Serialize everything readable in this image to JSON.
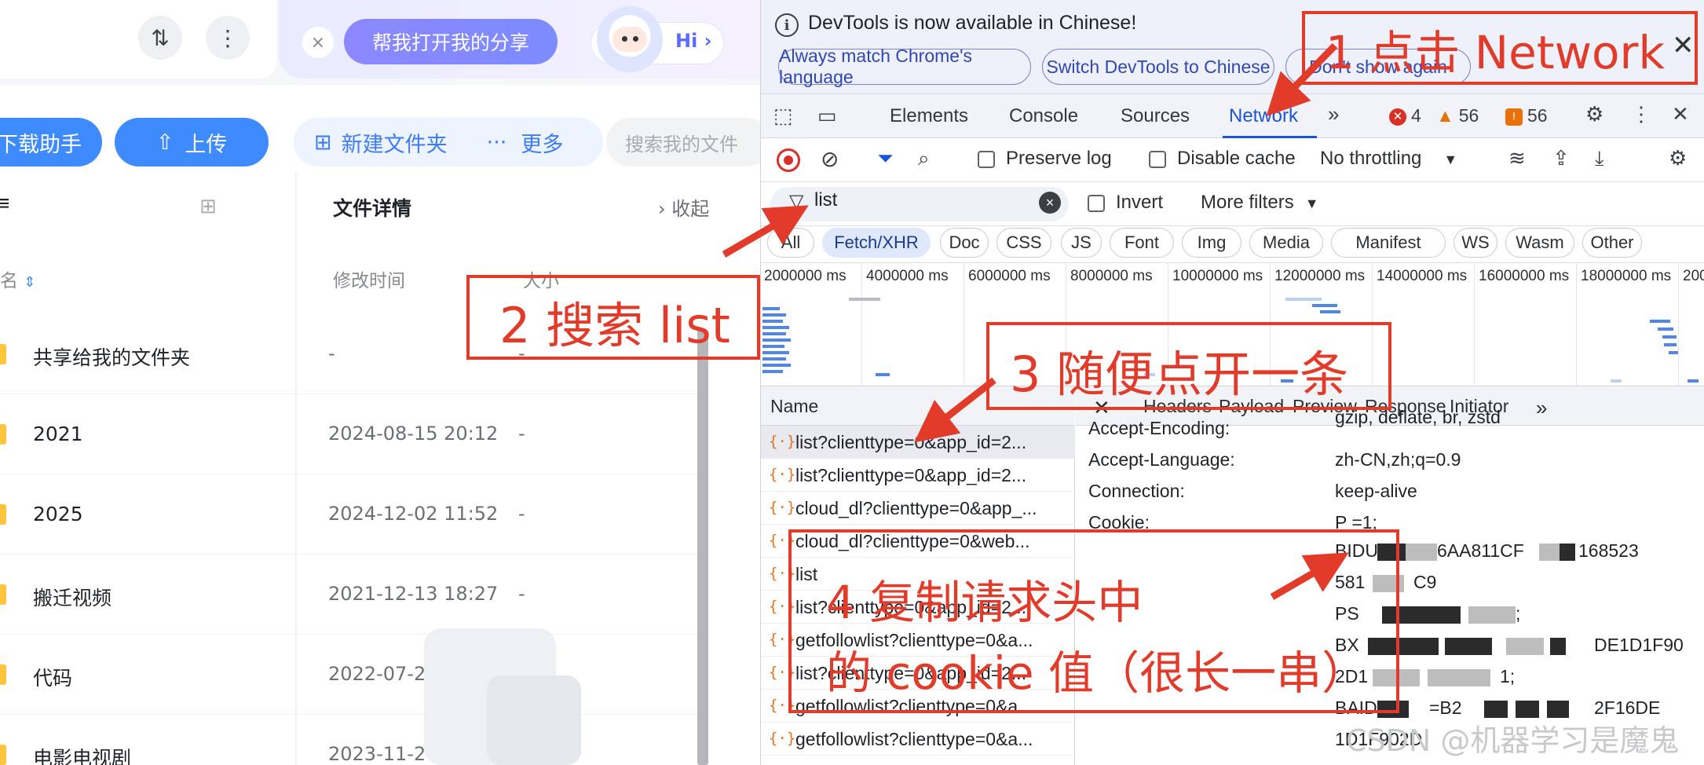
{
  "drive": {
    "ai_prompt": "帮我打开我的分享",
    "hi": "Hi",
    "download_btn": "下载助手",
    "upload_btn": "上传",
    "new_folder_btn": "新建文件夹",
    "more_btn": "更多",
    "search_placeholder": "搜索我的文件",
    "detail_title": "文件详情",
    "collapse": "收起",
    "col_name": "名",
    "col_modified": "修改时间",
    "col_size": "大小",
    "rows": [
      {
        "name": "共享给我的文件夹",
        "modified": "-",
        "size": "-"
      },
      {
        "name": "2021",
        "modified": "2024-08-15 20:12",
        "size": "-"
      },
      {
        "name": "2025",
        "modified": "2024-12-02 11:52",
        "size": "-"
      },
      {
        "name": "搬迁视频",
        "modified": "2021-12-13 18:27",
        "size": "-"
      },
      {
        "name": "代码",
        "modified": "2022-07-2",
        "size": ""
      },
      {
        "name": "电影电视剧",
        "modified": "2023-11-24 09:48",
        "size": ""
      }
    ]
  },
  "devtools": {
    "info_text": "DevTools is now available in Chinese!",
    "info_buttons": [
      "Always match Chrome's language",
      "Switch DevTools to Chinese",
      "Don't show again"
    ],
    "tabs": [
      "Elements",
      "Console",
      "Sources",
      "Network"
    ],
    "issues": {
      "errors": "4",
      "warnings": "56",
      "info": "56"
    },
    "preserve_log": "Preserve log",
    "disable_cache": "Disable cache",
    "throttling": "No throttling",
    "filter_value": "list",
    "invert": "Invert",
    "more_filters": "More filters",
    "type_filters": [
      "All",
      "Fetch/XHR",
      "Doc",
      "CSS",
      "JS",
      "Font",
      "Img",
      "Media",
      "Manifest",
      "WS",
      "Wasm",
      "Other"
    ],
    "timeline_ticks": [
      "2000000 ms",
      "4000000 ms",
      "6000000 ms",
      "8000000 ms",
      "10000000 ms",
      "12000000 ms",
      "14000000 ms",
      "16000000 ms",
      "18000000 ms",
      "200"
    ],
    "name_header": "Name",
    "requests": [
      "list?clienttype=0&app_id=2...",
      "list?clienttype=0&app_id=2...",
      "cloud_dl?clienttype=0&app_...",
      "cloud_dl?clienttype=0&web...",
      "list",
      "list?clienttype=0&app_id=2...",
      "getfollowlist?clienttype=0&a...",
      "list?clienttype=0&app_id=2...",
      "getfollowlist?clienttype=0&a...",
      "getfollowlist?clienttype=0&a..."
    ],
    "detail_tabs": [
      "Headers",
      "Payload",
      "Preview",
      "Response",
      "Initiator"
    ],
    "headers": [
      {
        "key": "Accept-Encoding:",
        "value": "gzip, deflate, br, zstd"
      },
      {
        "key": "Accept-Language:",
        "value": "zh-CN,zh;q=0.9"
      },
      {
        "key": "Connection:",
        "value": "keep-alive"
      },
      {
        "key": "Cookie:",
        "value": "P          =1;"
      }
    ],
    "cookie_fragments": [
      "BIDUP",
      "6AA811CF",
      "168523",
      "581",
      "C9",
      "PS",
      ";",
      "BX",
      "DE1D1F90",
      "2D1",
      "1;",
      "BAIDU",
      "=B2",
      "2F16DE",
      "1D1F902D"
    ]
  },
  "annotations": {
    "step1": "1 点击 Network",
    "step2": "2 搜索 list",
    "step3": "3 随便点开一条",
    "step4_line1": "4 复制请求头中",
    "step4_line2": "的 cookie 值（很长一串）"
  },
  "watermark": "CSDN @机器学习是魔鬼",
  "colors": {
    "annotation_red": "#e23b2a",
    "network_blue": "#1a55d6",
    "drive_blue": "#3d8bff"
  }
}
